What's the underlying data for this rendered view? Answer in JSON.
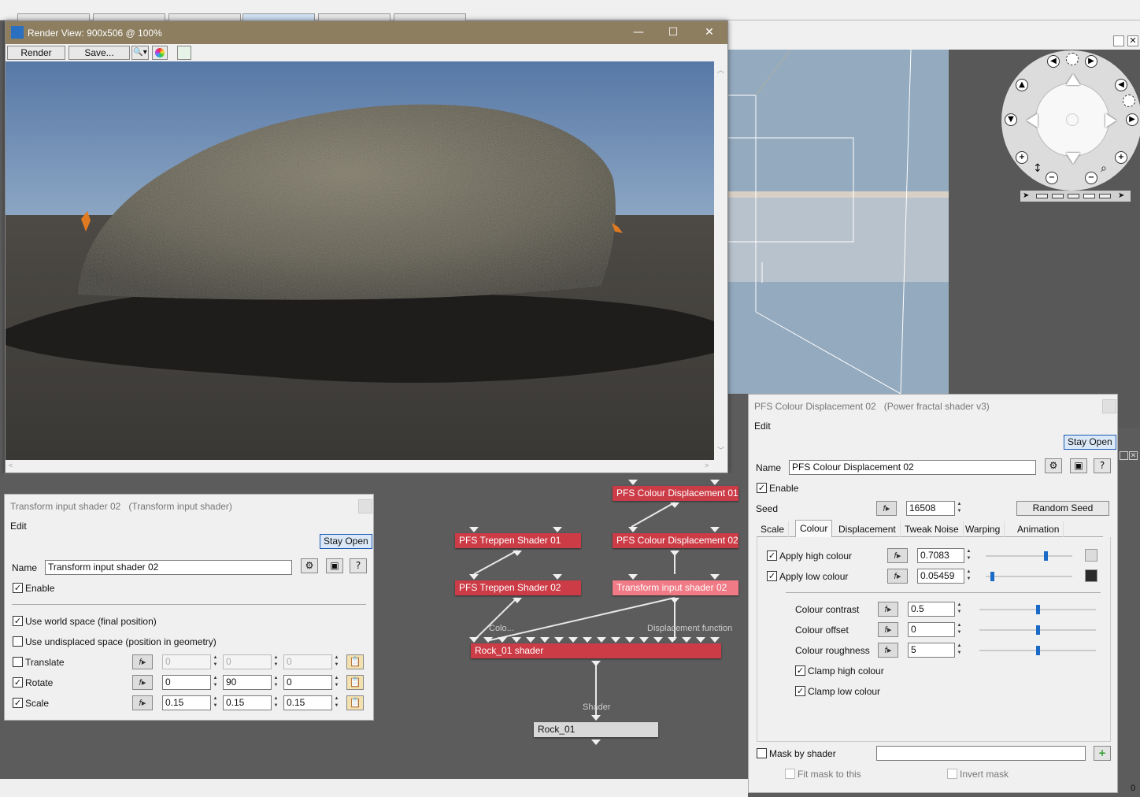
{
  "render_window": {
    "title": "Render View: 900x506 @ 100%",
    "render_button": "Render",
    "save_button": "Save..."
  },
  "transform_dialog": {
    "title": "Transform input shader 02",
    "subtitle": "(Transform input shader)",
    "menu_edit": "Edit",
    "stay_open": "Stay Open",
    "name_label": "Name",
    "name_value": "Transform input shader 02",
    "enable_label": "Enable",
    "use_world_space": "Use world space (final position)",
    "use_undisplaced": "Use undisplaced space (position in geometry)",
    "translate": {
      "label": "Translate",
      "x": "0",
      "y": "0",
      "z": "0"
    },
    "rotate": {
      "label": "Rotate",
      "x": "0",
      "y": "90",
      "z": "0"
    },
    "scale": {
      "label": "Scale",
      "x": "0.15",
      "y": "0.15",
      "z": "0.15"
    }
  },
  "colour_dialog": {
    "title": "PFS Colour Displacement 02",
    "subtitle": "(Power fractal shader v3)",
    "menu_edit": "Edit",
    "stay_open": "Stay Open",
    "name_label": "Name",
    "name_value": "PFS Colour Displacement 02",
    "enable_label": "Enable",
    "seed_label": "Seed",
    "seed_value": "16508",
    "random_seed": "Random Seed",
    "tabs": [
      "Scale",
      "Colour",
      "Displacement",
      "Tweak Noise",
      "Warping",
      "Animation"
    ],
    "active_tab": "Colour",
    "apply_high": {
      "label": "Apply high colour",
      "value": "0.7083",
      "slider": 0.7083,
      "color": "#dcdcdc"
    },
    "apply_low": {
      "label": "Apply low colour",
      "value": "0.05459",
      "slider": 0.05459,
      "color": "#2b2b2b"
    },
    "contrast": {
      "label": "Colour contrast",
      "value": "0.5",
      "slider": 0.5
    },
    "offset": {
      "label": "Colour offset",
      "value": "0",
      "slider": 0.5
    },
    "roughness": {
      "label": "Colour roughness",
      "value": "5",
      "slider": 0.5
    },
    "clamp_high": "Clamp high colour",
    "clamp_low": "Clamp low colour",
    "mask_label": "Mask by shader",
    "fit_mask": "Fit mask to this",
    "invert_mask": "Invert mask"
  },
  "node_graph": {
    "nodes": {
      "pfs_colour_01": "PFS Colour Displacement 01",
      "pfs_treppen_01": "PFS Treppen Shader 01",
      "pfs_colour_02": "PFS Colour Displacement 02",
      "pfs_treppen_02": "PFS Treppen Shader 02",
      "transform_02": "Transform input shader 02",
      "rock_shader": "Rock_01 shader",
      "rock": "Rock_01"
    },
    "labels": {
      "colo": "Colo...",
      "displacement_function": "Displacement function",
      "shader": "Shader"
    }
  },
  "status": {
    "count": "0"
  }
}
